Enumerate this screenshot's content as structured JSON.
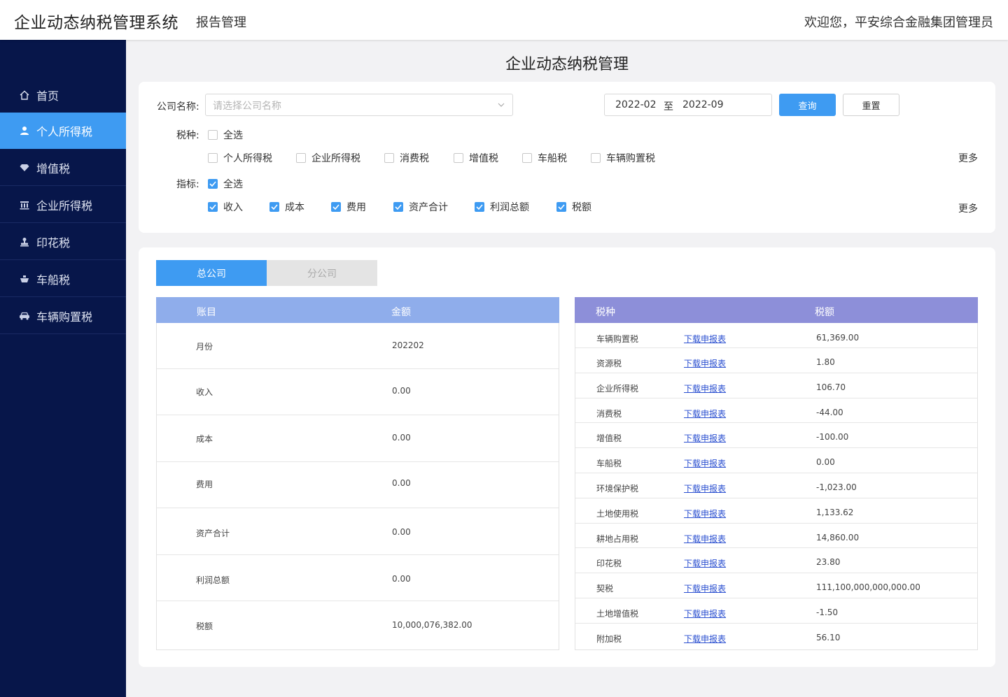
{
  "header": {
    "system_title": "企业动态纳税管理系统",
    "section": "报告管理",
    "welcome": "欢迎您，平安综合金融集团管理员"
  },
  "sidebar": {
    "items": [
      {
        "label": "首页",
        "icon": "home-icon"
      },
      {
        "label": "个人所得税",
        "icon": "user-icon",
        "active": true
      },
      {
        "label": "增值税",
        "icon": "diamond-icon"
      },
      {
        "label": "企业所得税",
        "icon": "building-icon"
      },
      {
        "label": "印花税",
        "icon": "stamp-icon"
      },
      {
        "label": "车船税",
        "icon": "ship-icon"
      },
      {
        "label": "车辆购置税",
        "icon": "car-icon"
      }
    ]
  },
  "main": {
    "title": "企业动态纳税管理"
  },
  "filter": {
    "company_label": "公司名称:",
    "company_placeholder": "请选择公司名称",
    "date_start": "2022-02",
    "date_sep": "至",
    "date_end": "2022-09",
    "query_label": "查询",
    "reset_label": "重置",
    "tax_label": "税种:",
    "tax_all": "全选",
    "tax_types": [
      "个人所得税",
      "企业所得税",
      "消费税",
      "增值税",
      "车船税",
      "车辆购置税"
    ],
    "indicator_label": "指标:",
    "indicator_all": "全选",
    "indicators": [
      "收入",
      "成本",
      "费用",
      "资产合计",
      "利润总额",
      "税额"
    ],
    "more_label": "更多"
  },
  "tabs": [
    {
      "label": "总公司",
      "active": true
    },
    {
      "label": "分公司",
      "active": false
    }
  ],
  "summary_table": {
    "headers": [
      "账目",
      "金额"
    ],
    "rows": [
      [
        "月份",
        "202202"
      ],
      [
        "收入",
        "0.00"
      ],
      [
        "成本",
        "0.00"
      ],
      [
        "费用",
        "0.00"
      ],
      [
        "资产合计",
        "0.00"
      ],
      [
        "利润总额",
        "0.00"
      ],
      [
        "税额",
        "10,000,076,382.00"
      ]
    ]
  },
  "tax_table": {
    "headers": [
      "税种",
      "税额"
    ],
    "link_label": "下载申报表",
    "rows": [
      [
        "车辆购置税",
        "61,369.00"
      ],
      [
        "资源税",
        "1.80"
      ],
      [
        "企业所得税",
        "106.70"
      ],
      [
        "消费税",
        "-44.00"
      ],
      [
        "增值税",
        "-100.00"
      ],
      [
        "车船税",
        "0.00"
      ],
      [
        "环境保护税",
        "-1,023.00"
      ],
      [
        "土地使用税",
        "1,133.62"
      ],
      [
        "耕地占用税",
        "14,860.00"
      ],
      [
        "印花税",
        "23.80"
      ],
      [
        "契税",
        "111,100,000,000,000.00"
      ],
      [
        "土地增值税",
        "-1.50"
      ],
      [
        "附加税",
        "56.10"
      ]
    ]
  },
  "colors": {
    "sidebar_bg": "#07164a",
    "accent": "#3e9bf2",
    "left_header": "#8fadeb",
    "right_header": "#8d8fd9",
    "link": "#2a4fd0"
  }
}
